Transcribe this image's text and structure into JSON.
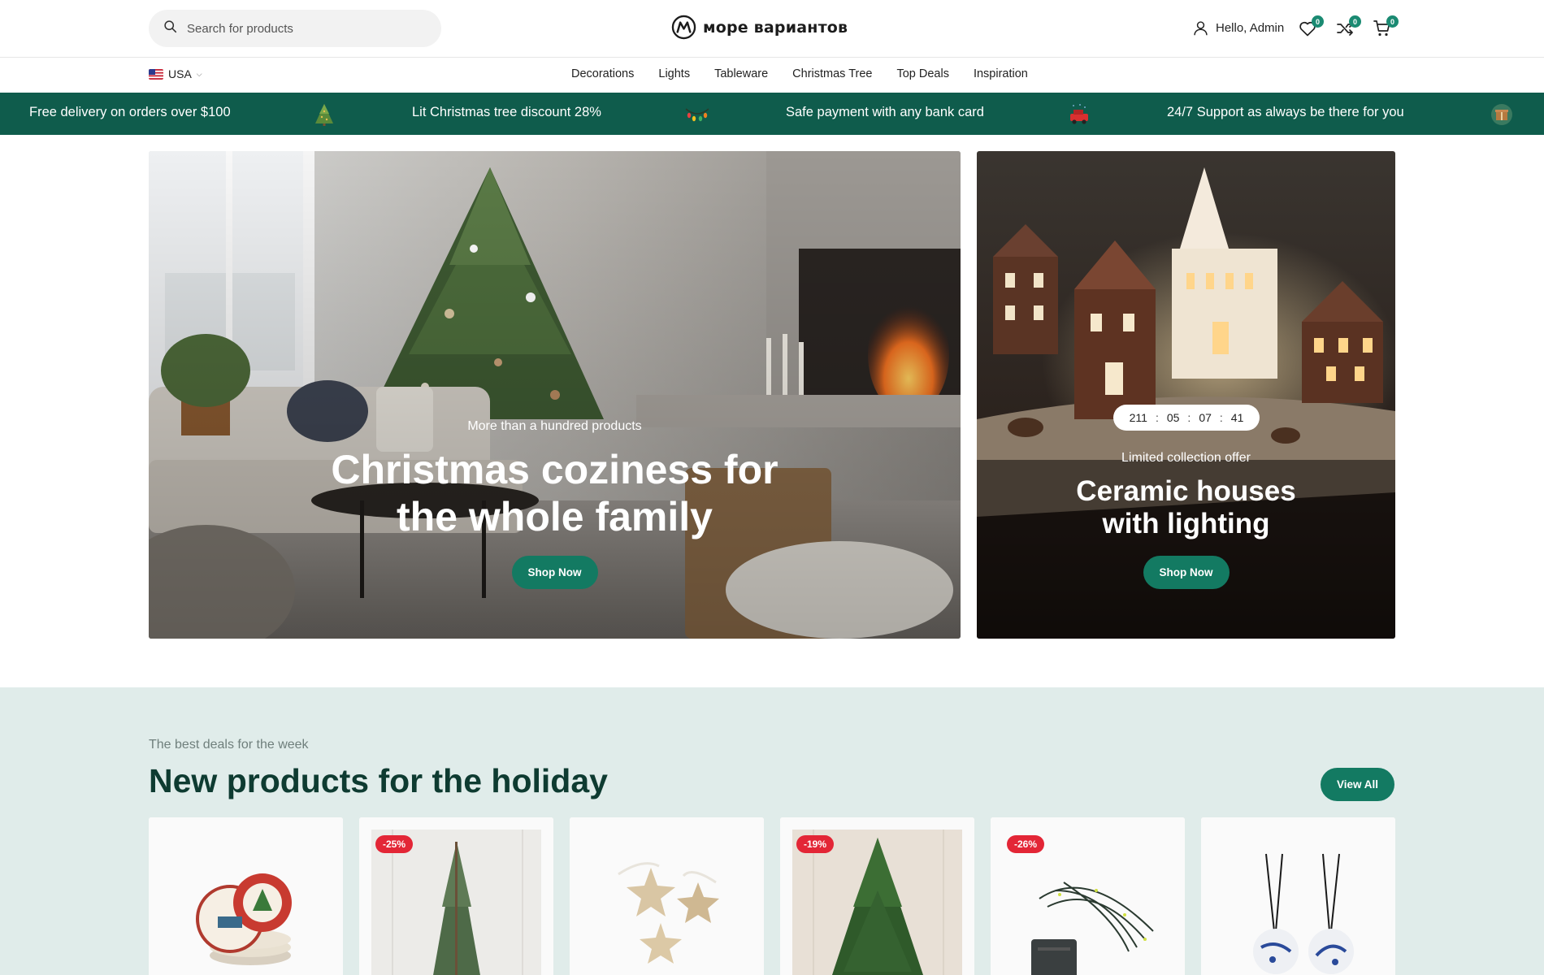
{
  "header": {
    "search_placeholder": "Search for products",
    "logo_text": "море вариантов",
    "greeting": "Hello, Admin",
    "wishlist_count": "0",
    "compare_count": "0",
    "cart_count": "0"
  },
  "locale": {
    "country": "USA"
  },
  "nav": {
    "items": [
      "Decorations",
      "Lights",
      "Tableware",
      "Christmas Tree",
      "Top Deals",
      "Inspiration"
    ]
  },
  "promo": {
    "items": [
      "Free delivery on orders over $100",
      "Lit Christmas tree discount 28%",
      "Safe payment with any bank card",
      "24/7 Support as always be there for you"
    ],
    "icons": [
      "christmas-tree-icon",
      "string-lights-icon",
      "gift-car-icon",
      "gift-box-icon"
    ]
  },
  "hero_main": {
    "subtitle": "More than a hundred products",
    "title_line1": "Christmas coziness for",
    "title_line2": "the whole family",
    "cta": "Shop Now"
  },
  "hero_side": {
    "countdown": {
      "days": "211",
      "hours": "05",
      "minutes": "07",
      "seconds": "41",
      "separator": ":"
    },
    "subtitle": "Limited collection offer",
    "title_line1": "Ceramic houses",
    "title_line2": "with lighting",
    "cta": "Shop Now"
  },
  "deals": {
    "kicker": "The best deals for the week",
    "title": "New products for the holiday",
    "view_all": "View All",
    "products": [
      {
        "image": "christmas-plates",
        "discount": ""
      },
      {
        "image": "slim-fir-tree",
        "discount": "-25%"
      },
      {
        "image": "wooden-stars",
        "discount": ""
      },
      {
        "image": "potted-christmas-tree",
        "discount": "-19%"
      },
      {
        "image": "led-string-lights",
        "discount": "-26%"
      },
      {
        "image": "ceramic-baubles",
        "discount": ""
      }
    ]
  },
  "colors": {
    "brand_green": "#137a62",
    "promo_bar": "#0f5c4c",
    "badge_red": "#e32636",
    "section_bg": "#e0ecea"
  }
}
